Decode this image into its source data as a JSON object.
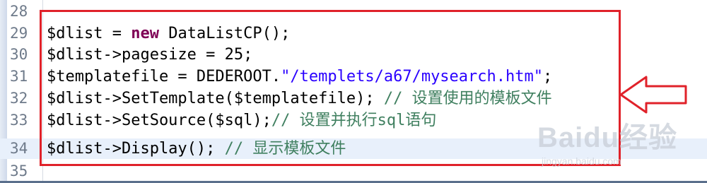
{
  "lines": [
    {
      "num": "28",
      "text": ""
    },
    {
      "num": "29",
      "segments": [
        {
          "t": "$dlist = ",
          "c": ""
        },
        {
          "t": "new",
          "c": "kw"
        },
        {
          "t": " DataListCP();",
          "c": ""
        }
      ]
    },
    {
      "num": "30",
      "segments": [
        {
          "t": "$dlist->pagesize = 25;",
          "c": ""
        }
      ]
    },
    {
      "num": "31",
      "segments": [
        {
          "t": "$templatefile = DEDEROOT.",
          "c": ""
        },
        {
          "t": "\"/templets/a67/mysearch.htm\"",
          "c": "str"
        },
        {
          "t": ";",
          "c": ""
        }
      ]
    },
    {
      "num": "32",
      "segments": [
        {
          "t": "$dlist->SetTemplate($templatefile); ",
          "c": ""
        },
        {
          "t": "// 设置使用的模板文件",
          "c": "cm"
        }
      ]
    },
    {
      "num": "33",
      "segments": [
        {
          "t": "$dlist->SetSource($sql);",
          "c": ""
        },
        {
          "t": "// 设置并执行sql语句",
          "c": "cm"
        }
      ]
    },
    {
      "num": "34",
      "segments": [
        {
          "t": "$dlist->Display(); ",
          "c": ""
        },
        {
          "t": "// 显示模板文件",
          "c": "cm"
        }
      ]
    },
    {
      "num": "35",
      "text": ""
    }
  ],
  "watermark": {
    "logo": "Baidu经验",
    "sub": "jingyan.baidu.com"
  },
  "colors": {
    "keyword": "#7f0055",
    "string": "#2a00ff",
    "comment": "#3f7f5f",
    "annotation": "#e0222a"
  }
}
